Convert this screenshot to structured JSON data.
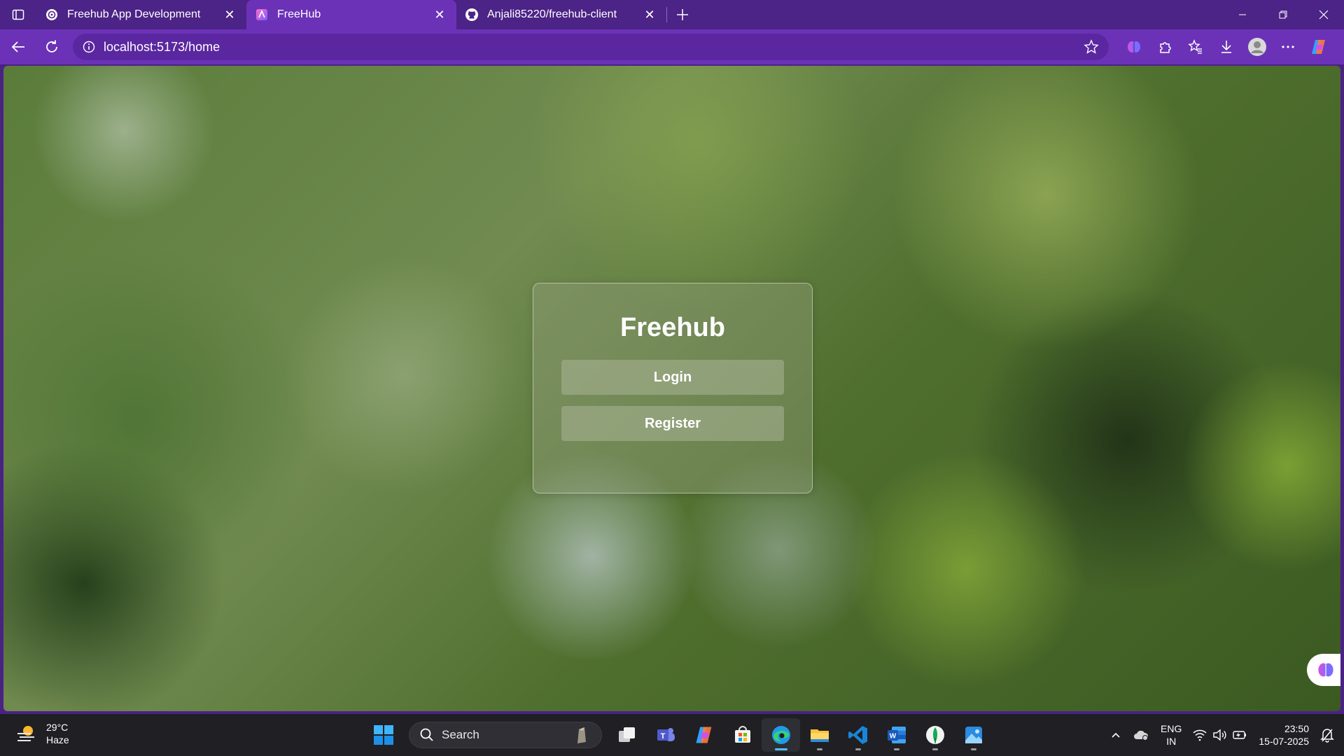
{
  "browser": {
    "tabs": [
      {
        "title": "Freehub App Development",
        "favicon": "chatgpt-icon",
        "active": false
      },
      {
        "title": "FreeHub",
        "favicon": "vite-app-icon",
        "active": true
      },
      {
        "title": "Anjali85220/freehub-client",
        "favicon": "github-icon",
        "active": false
      }
    ],
    "url": "localhost:5173/home",
    "accent_color": "#6b32b8"
  },
  "page": {
    "title": "Freehub",
    "login_label": "Login",
    "register_label": "Register"
  },
  "taskbar": {
    "weather_temp": "29°C",
    "weather_desc": "Haze",
    "search_label": "Search",
    "lang_top": "ENG",
    "lang_bottom": "IN",
    "time": "23:50",
    "date": "15-07-2025",
    "apps": [
      "task-view-icon",
      "teams-icon",
      "copilot-icon",
      "store-icon",
      "edge-icon",
      "file-explorer-icon",
      "vscode-icon",
      "word-icon",
      "mongodb-compass-icon",
      "photos-icon"
    ]
  }
}
